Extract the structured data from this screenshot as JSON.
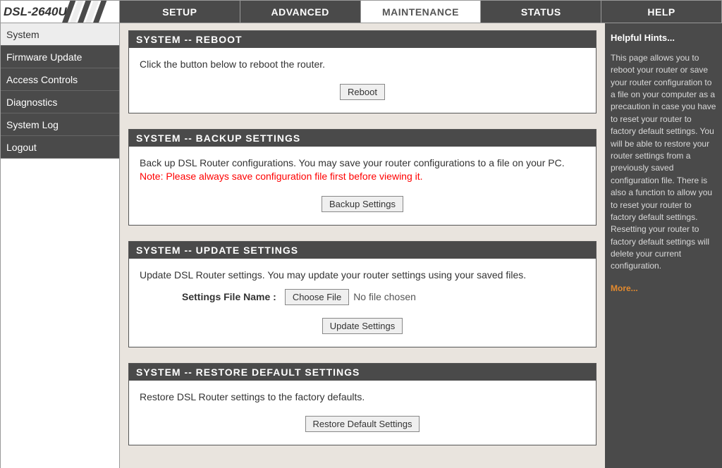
{
  "product_model": "DSL-2640U",
  "top_nav": {
    "setup": "SETUP",
    "advanced": "ADVANCED",
    "maintenance": "MAINTENANCE",
    "status": "STATUS",
    "help": "HELP",
    "active": "maintenance"
  },
  "sidebar": {
    "items": [
      {
        "label": "System",
        "active": true
      },
      {
        "label": "Firmware Update",
        "active": false
      },
      {
        "label": "Access Controls",
        "active": false
      },
      {
        "label": "Diagnostics",
        "active": false
      },
      {
        "label": "System Log",
        "active": false
      },
      {
        "label": "Logout",
        "active": false
      }
    ]
  },
  "panels": {
    "reboot": {
      "title": "SYSTEM -- REBOOT",
      "desc": "Click the button below to reboot the router.",
      "button": "Reboot"
    },
    "backup": {
      "title": "SYSTEM -- BACKUP SETTINGS",
      "desc": "Back up DSL Router configurations. You may save your router configurations to a file on your PC.",
      "note": "Note: Please always save configuration file first before viewing it.",
      "button": "Backup Settings"
    },
    "update": {
      "title": "SYSTEM -- UPDATE SETTINGS",
      "desc": "Update DSL Router settings. You may update your router settings using your saved files.",
      "file_label": "Settings File Name :",
      "choose_file": "Choose File",
      "no_file": "No file chosen",
      "button": "Update Settings"
    },
    "restore": {
      "title": "SYSTEM -- RESTORE DEFAULT SETTINGS",
      "desc": "Restore DSL Router settings to the factory defaults.",
      "button": "Restore Default Settings"
    }
  },
  "help": {
    "title": "Helpful Hints...",
    "body": "This page allows you to reboot your router or save your router configuration to a file on your computer as a precaution in case you have to reset your router to factory default settings. You will be able to restore your router settings from a previously saved configuration file. There is also a function to allow you to reset your router to factory default settings. Resetting your router to factory default settings will delete your current configuration.",
    "more": "More..."
  }
}
